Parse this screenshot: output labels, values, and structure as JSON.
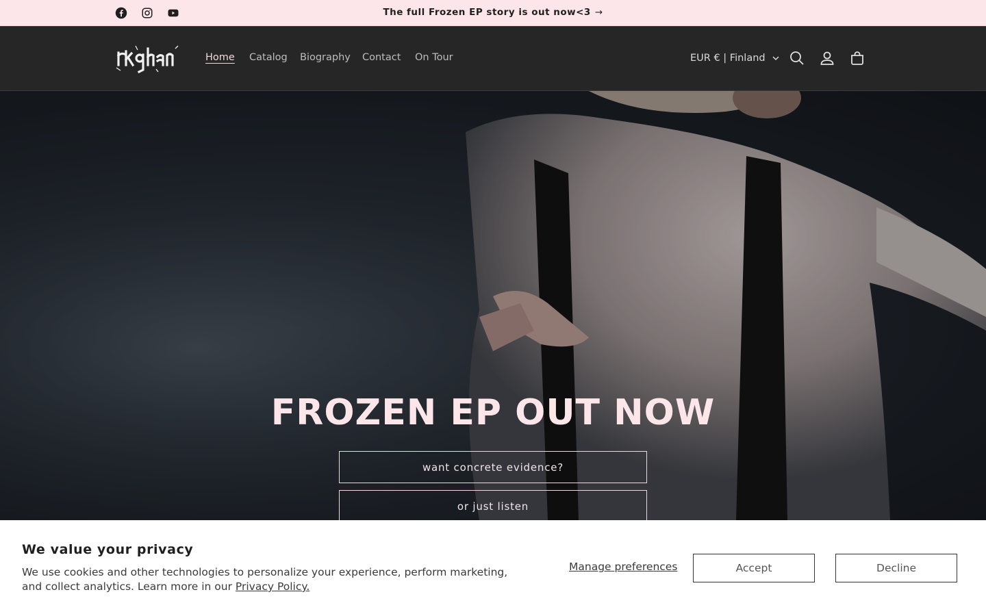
{
  "announcement": {
    "text": "The full Frozen EP story is out now<3",
    "arrow": "→",
    "social": [
      "facebook-icon",
      "instagram-icon",
      "youtube-icon"
    ]
  },
  "header": {
    "logo_text": "rkqhan",
    "nav": [
      "Home",
      "Catalog",
      "Biography",
      "Contact",
      "On Tour"
    ],
    "active_nav": "Home",
    "currency": "EUR € | Finland",
    "icons": [
      "search-icon",
      "account-icon",
      "cart-icon"
    ]
  },
  "hero": {
    "title": "FROZEN EP OUT NOW",
    "button1": "want concrete evidence?",
    "button2": "or just listen"
  },
  "cookie": {
    "title": "We value your privacy",
    "text": "We use cookies and other technologies to personalize your experience, perform marketing, and collect analytics. Learn more in our",
    "policy_link": "Privacy Policy.",
    "manage": "Manage preferences",
    "accept": "Accept",
    "decline": "Decline"
  },
  "colors": {
    "announcement_bg": "#fde6e9",
    "header_bg": "#262626",
    "accent_pink": "#fde6e9"
  }
}
